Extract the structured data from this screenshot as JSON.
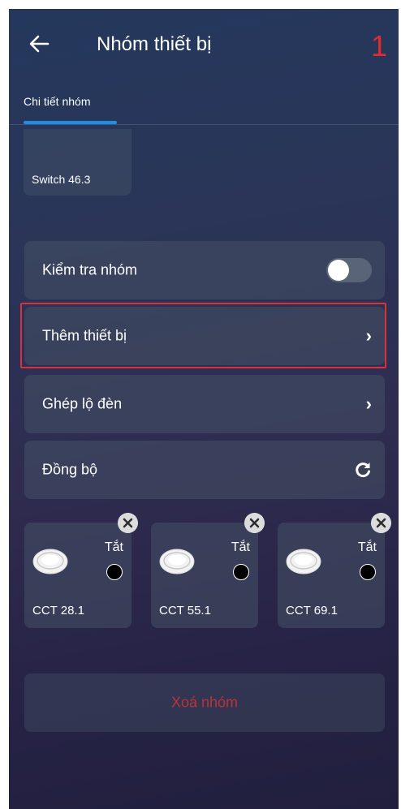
{
  "header": {
    "title": "Nhóm thiết bị",
    "annotation_number": "1"
  },
  "tabs": [
    {
      "label": "Chi tiết nhóm",
      "active": true
    }
  ],
  "switch_card": {
    "label": "Switch 46.3"
  },
  "menu": {
    "check_group": {
      "label": "Kiểm tra nhóm",
      "toggle_on": false
    },
    "add_device": {
      "label": "Thêm thiết bị"
    },
    "pair_light": {
      "label": "Ghép lộ đèn"
    },
    "sync": {
      "label": "Đồng bộ"
    }
  },
  "devices": [
    {
      "name": "CCT 28.1",
      "state": "Tắt"
    },
    {
      "name": "CCT 55.1",
      "state": "Tắt"
    },
    {
      "name": "CCT 69.1",
      "state": "Tắt"
    }
  ],
  "delete_button": {
    "label": "Xoá nhóm"
  },
  "colors": {
    "highlight": "#d8323a",
    "tab_indicator": "#1e8fe8",
    "delete_text": "#b9343a"
  },
  "icons": [
    "back-arrow-icon",
    "chevron-right-icon",
    "refresh-icon",
    "close-icon",
    "ceiling-light-icon"
  ]
}
